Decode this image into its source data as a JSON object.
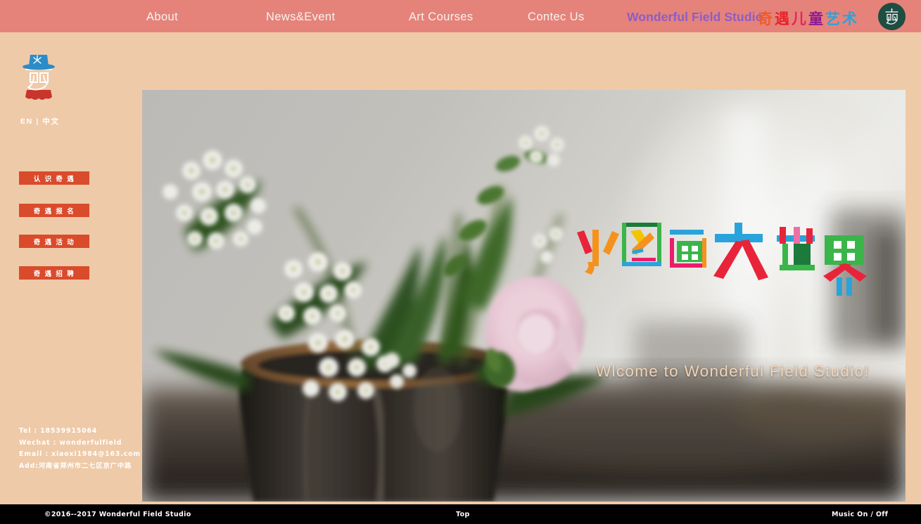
{
  "nav": {
    "links": [
      {
        "label": "About",
        "name": "nav-about"
      },
      {
        "label": "News&Event",
        "name": "nav-news"
      },
      {
        "label": "Art Courses",
        "name": "nav-courses"
      },
      {
        "label": "Contec  Us",
        "name": "nav-contact"
      }
    ],
    "brand_en": "Wonderful Field Studio",
    "brand_cn_chars": [
      {
        "char": "奇",
        "color": "#F05A28"
      },
      {
        "char": "遇",
        "color": "#E8242B"
      },
      {
        "char": "儿",
        "color": "#E8245C"
      },
      {
        "char": "童",
        "color": "#8E1A8E"
      },
      {
        "char": "艺",
        "color": "#29A3DC"
      },
      {
        "char": "术",
        "color": "#29A3DC"
      }
    ],
    "logo_icon": "studio-badge-icon",
    "background_color": "#E5837A"
  },
  "sidebar": {
    "logo_icon": "studio-mascot-logo",
    "language": {
      "en_label": "EN",
      "separator": "|",
      "cn_label": "中文"
    },
    "buttons": [
      {
        "label": "认 识 奇 遇",
        "name": "btn-know"
      },
      {
        "label": "奇 遇 报 名",
        "name": "btn-signup"
      },
      {
        "label": "奇 遇 活 动",
        "name": "btn-events"
      },
      {
        "label": "奇 遇 招 聘",
        "name": "btn-jobs"
      }
    ],
    "button_color": "#D94B2B",
    "background_color": "#EFCAA9",
    "contact": {
      "tel": "Tel : 18539915064",
      "wechat": "Wechat : wonderfulfield",
      "email": "Email : xiaoxi1984@163.com",
      "address": "Add:河南省郑州市二七区京广中路"
    }
  },
  "hero": {
    "alt": "blurred photo of white spirea flowers and a pink rose in a dark ceramic vase by a bright window",
    "title_chars": [
      {
        "char": "小",
        "color": "#F5921E"
      },
      {
        "char": "图",
        "color": "#3AB54A"
      },
      {
        "char": "画",
        "color": "#EC1C6A"
      },
      {
        "char": "大",
        "color": "#E8243B"
      },
      {
        "char": "世",
        "color": "#2BB673"
      },
      {
        "char": "界",
        "color": "#3AB54A"
      }
    ],
    "welcome_text": "Wlcome to Wonderful Field Studio!",
    "welcome_color": "#F2D3B4"
  },
  "footer": {
    "copyright": "©2016--2017  Wonderful Field Studio",
    "top_label": "Top",
    "music_label": "Music  On / Off",
    "background_color": "#000000"
  }
}
